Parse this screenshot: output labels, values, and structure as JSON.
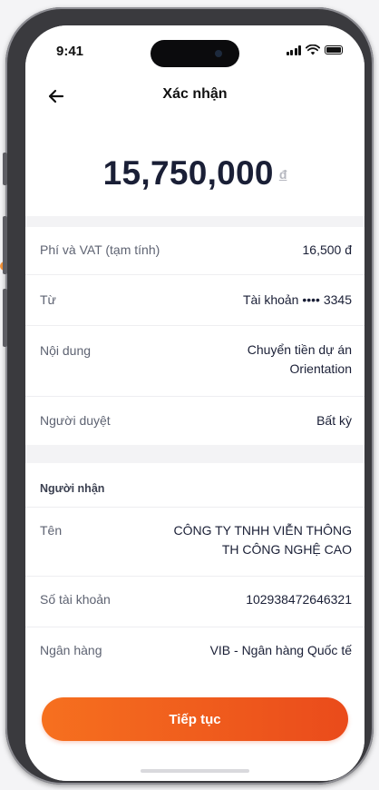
{
  "status_bar": {
    "time": "9:41"
  },
  "header": {
    "title": "Xác nhận"
  },
  "amount": {
    "value": "15,750,000",
    "currency": "đ"
  },
  "details": [
    {
      "label": "Phí và VAT (tạm tính)",
      "value": "16,500 đ"
    },
    {
      "label": "Từ",
      "value": "Tài khoản •••• 3345"
    },
    {
      "label": "Nội dung",
      "value_line1": "Chuyển tiền dự án",
      "value_line2": "Orientation"
    },
    {
      "label": "Người duyệt",
      "value": "Bất kỳ"
    }
  ],
  "recipient": {
    "section_title": "Người nhận",
    "rows": [
      {
        "label": "Tên",
        "value_line1": "CÔNG TY TNHH VIỄN THÔNG",
        "value_line2": "TH CÔNG NGHỆ CAO"
      },
      {
        "label": "Số tài khoản",
        "value": "102938472646321"
      },
      {
        "label": "Ngân hàng",
        "value": "VIB - Ngân hàng Quốc tế"
      }
    ]
  },
  "actions": {
    "continue_label": "Tiếp tục"
  },
  "colors": {
    "accent_start": "#f6701f",
    "accent_end": "#ea4b1b",
    "text_primary": "#1a1f36"
  }
}
